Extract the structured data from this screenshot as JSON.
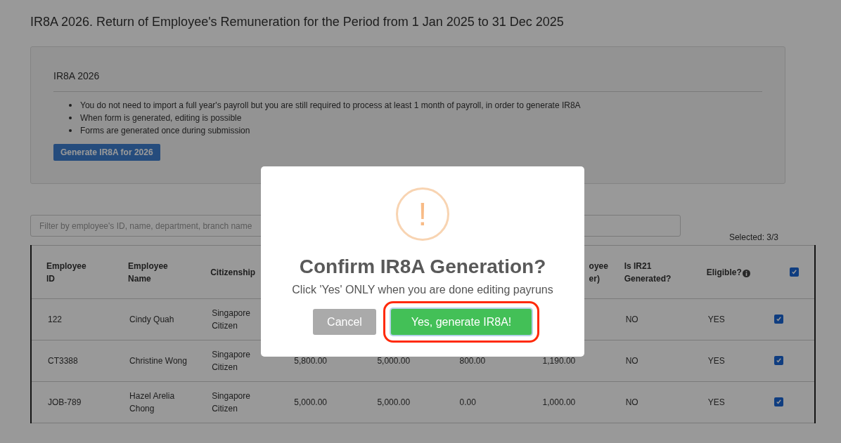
{
  "page_title": "IR8A 2026. Return of Employee's Remuneration for the Period from 1 Jan 2025 to 31 Dec 2025",
  "panel": {
    "heading": "IR8A 2026",
    "notes": [
      "You do not need to import a full year's payroll but you are still required to process at least 1 month of payroll, in order to generate IR8A",
      "When form is generated, editing is possible",
      "Forms are generated once during submission"
    ],
    "button": "Generate IR8A for 2026"
  },
  "filter": {
    "placeholder": "Filter by employee's ID, name, department, branch name"
  },
  "selected_count": "Selected: 3/3",
  "table": {
    "columns": [
      {
        "label": "Employee ID"
      },
      {
        "label": "Employee Name"
      },
      {
        "label": "Citizenship"
      },
      {},
      {},
      {},
      {
        "lines": [
          "oyee",
          "er)"
        ],
        "kind": "fragment"
      },
      {
        "label": "Is IR21 Generated?"
      },
      {
        "label": "Eligible?",
        "info": true
      }
    ],
    "all_checked": true,
    "rows": [
      {
        "cells": [
          "122",
          "Cindy Quah",
          "Singapore Citizen",
          null,
          null,
          null,
          null,
          "NO",
          "YES"
        ],
        "checked": true
      },
      {
        "cells": [
          "CT3388",
          "Christine Wong",
          "Singapore Citizen",
          "5,800.00",
          "5,000.00",
          "800.00",
          "1,190.00",
          "NO",
          "YES"
        ],
        "checked": true
      },
      {
        "cells": [
          "JOB-789",
          "Hazel Arelia Chong",
          "Singapore Citizen",
          "5,000.00",
          "5,000.00",
          "0.00",
          "1,000.00",
          "NO",
          "YES"
        ],
        "checked": true
      }
    ]
  },
  "dialog": {
    "icon": "!",
    "title": "Confirm IR8A Generation?",
    "message": "Click 'Yes' ONLY when you are done editing payruns",
    "cancel": "Cancel",
    "confirm": "Yes, generate IR8A!",
    "confirm_highlighted": true
  }
}
